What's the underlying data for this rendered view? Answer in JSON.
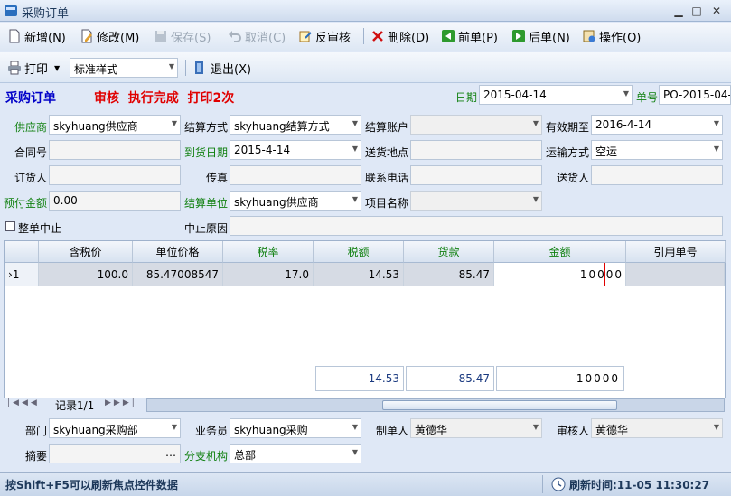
{
  "window": {
    "title": "采购订单"
  },
  "toolbar1": [
    {
      "label": "新增(N)",
      "icon": "new-doc-icon",
      "disabled": false
    },
    {
      "label": "修改(M)",
      "icon": "edit-icon",
      "disabled": false
    },
    {
      "label": "保存(S)",
      "icon": "save-icon",
      "disabled": true
    },
    {
      "label": "取消(C)",
      "icon": "undo-icon",
      "disabled": true
    },
    {
      "label": "反审核",
      "icon": "unaudit-icon",
      "disabled": false
    },
    {
      "label": "删除(D)",
      "icon": "delete-icon",
      "disabled": false
    },
    {
      "label": "前单(P)",
      "icon": "prev-icon",
      "disabled": false
    },
    {
      "label": "后单(N)",
      "icon": "next-icon",
      "disabled": false
    },
    {
      "label": "操作(O)",
      "icon": "operate-icon",
      "disabled": false
    }
  ],
  "toolbar2": {
    "print_label": "打印",
    "print_style": "标准样式",
    "exit_label": "退出(X)"
  },
  "header": {
    "title": "采购订单",
    "status": "审核  执行完成  打印2次",
    "date_label": "日期",
    "date_value": "2015-04-14",
    "no_label": "单号",
    "no_value": "PO-2015-04-"
  },
  "form": {
    "supplier_label": "供应商",
    "supplier": "skyhuang供应商",
    "settle_method_label": "结算方式",
    "settle_method": "skyhuang结算方式",
    "settle_account_label": "结算账户",
    "settle_account": "",
    "valid_until_label": "有效期至",
    "valid_until": "2016-4-14",
    "contract_label": "合同号",
    "contract": "",
    "arrive_date_label": "到货日期",
    "arrive_date": "2015-4-14",
    "delivery_place_label": "送货地点",
    "delivery_place": "",
    "transport_label": "运输方式",
    "transport": "空运",
    "orderer_label": "订货人",
    "orderer": "",
    "fax_label": "传真",
    "fax": "",
    "phone_label": "联系电话",
    "phone": "",
    "deliverer_label": "送货人",
    "deliverer": "",
    "prepay_label": "预付金额",
    "prepay": "0.00",
    "settle_unit_label": "结算单位",
    "settle_unit": "skyhuang供应商",
    "project_label": "项目名称",
    "project": "",
    "stop_label": "整单中止",
    "stop_reason_label": "中止原因",
    "stop_reason": ""
  },
  "grid": {
    "columns": [
      "含税价",
      "单位价格",
      "税率",
      "税额",
      "货款",
      "金额",
      "引用单号"
    ],
    "rows": [
      {
        "index": "1",
        "tax_price": "100.0",
        "unit_price": "85.47008547",
        "tax_rate": "17.0",
        "tax_amount": "14.53",
        "goods": "85.47",
        "amount_digits": "10000",
        "ref": ""
      }
    ],
    "summary": {
      "tax_amount": "14.53",
      "goods": "85.47",
      "amount_digits": "10000"
    },
    "nav_record": "记录1/1"
  },
  "footer": {
    "dept_label": "部门",
    "dept": "skyhuang采购部",
    "salesman_label": "业务员",
    "salesman": "skyhuang采购",
    "maker_label": "制单人",
    "maker": "黄德华",
    "auditor_label": "审核人",
    "auditor": "黄德华",
    "memo_label": "摘要",
    "memo": "",
    "branch_label": "分支机构",
    "branch": "总部"
  },
  "status": {
    "hint": "按Shift+F5可以刷新焦点控件数据",
    "refresh": "刷新时间:11-05 11:30:27"
  },
  "colors": {
    "accent_green": "#108010",
    "title_blue": "#0000c8",
    "status_red": "#e00000"
  }
}
